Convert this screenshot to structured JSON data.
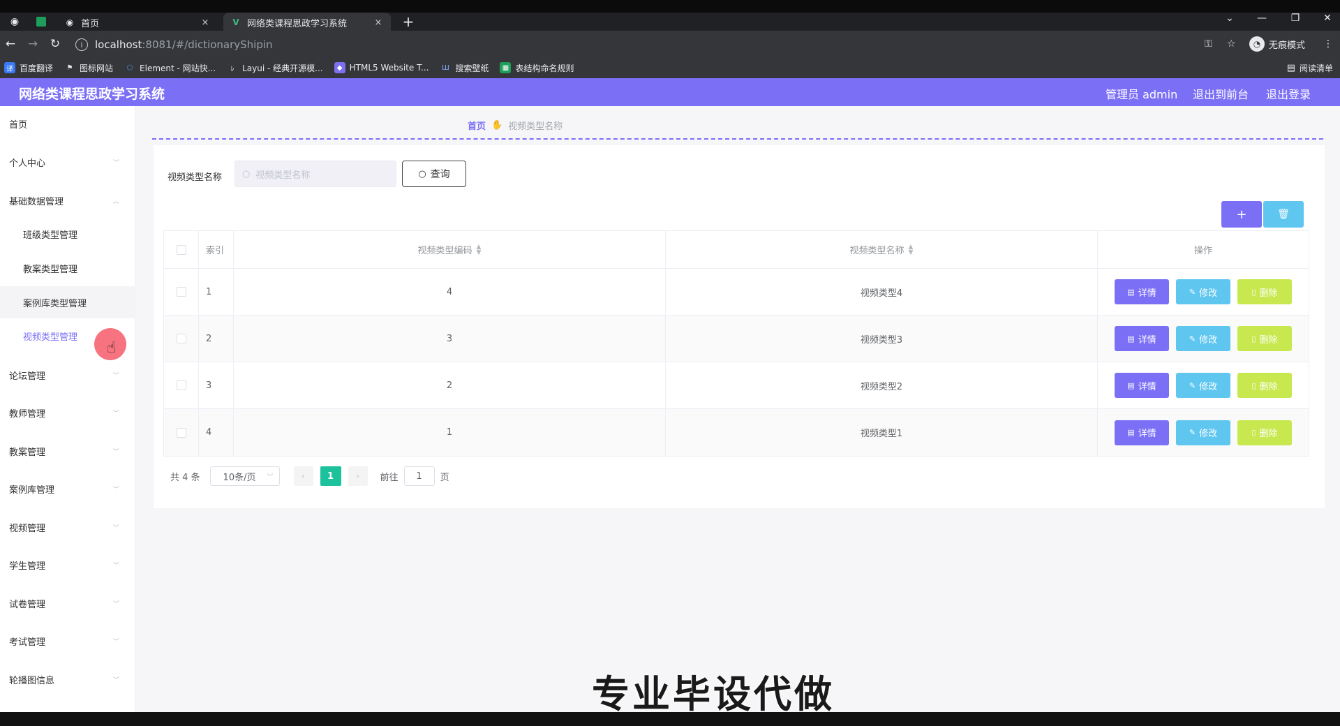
{
  "browser": {
    "tabs": [
      {
        "title": "首页",
        "close": "×"
      },
      {
        "title": "网络类课程思政学习系统",
        "close": "×"
      }
    ],
    "new_tab": "+",
    "url": {
      "host": "localhost",
      "path": ":8081/#/dictionaryShipin"
    },
    "incognito_label": "无痕模式",
    "bookmarks": [
      {
        "label": "百度翻译",
        "icon": "baidu-translate-icon",
        "color": "#3a79f5"
      },
      {
        "label": "图标网站",
        "icon": "flag-icon",
        "color": "#555"
      },
      {
        "label": "Element - 网站快...",
        "icon": "element-icon",
        "color": "#4a90e2"
      },
      {
        "label": "Layui - 经典开源模...",
        "icon": "layui-icon",
        "color": "#666"
      },
      {
        "label": "HTML5 Website T...",
        "icon": "html5-icon",
        "color": "#7c6ff0"
      },
      {
        "label": "搜索壁纸",
        "icon": "wallpaper-icon",
        "color": "#3b6fd6"
      },
      {
        "label": "表结构命名规则",
        "icon": "sheet-icon",
        "color": "#1e9e5a"
      }
    ],
    "reading_list": "阅读清单"
  },
  "app": {
    "title": "网络类课程思政学习系统",
    "header_links": {
      "user": "管理员 admin",
      "front": "退出到前台",
      "logout": "退出登录"
    },
    "accent": "#7b6ff6"
  },
  "sidebar": {
    "home": "首页",
    "personal": "个人中心",
    "basic_data": "基础数据管理",
    "sub_items": [
      "班级类型管理",
      "教案类型管理",
      "案例库类型管理",
      "视频类型管理"
    ],
    "groups": [
      "论坛管理",
      "教师管理",
      "教案管理",
      "案例库管理",
      "视频管理",
      "学生管理",
      "试卷管理",
      "考试管理",
      "轮播图信息"
    ]
  },
  "breadcrumb": {
    "home": "首页",
    "current": "视频类型名称"
  },
  "search": {
    "label": "视频类型名称",
    "placeholder": "视频类型名称",
    "button": "查询"
  },
  "table": {
    "headers": {
      "index": "索引",
      "code": "视频类型编码",
      "name": "视频类型名称",
      "ops": "操作"
    },
    "rows": [
      {
        "index": "1",
        "code": "4",
        "name": "视频类型4"
      },
      {
        "index": "2",
        "code": "3",
        "name": "视频类型3"
      },
      {
        "index": "3",
        "code": "2",
        "name": "视频类型2"
      },
      {
        "index": "4",
        "code": "1",
        "name": "视频类型1"
      }
    ],
    "ops": {
      "detail": "详情",
      "edit": "修改",
      "delete": "删除"
    }
  },
  "pagination": {
    "total": "共 4 条",
    "size": "10条/页",
    "page": "1",
    "goto": "前往",
    "goto_value": "1",
    "page_suffix": "页"
  },
  "overlay_caption": "专业毕设代做"
}
